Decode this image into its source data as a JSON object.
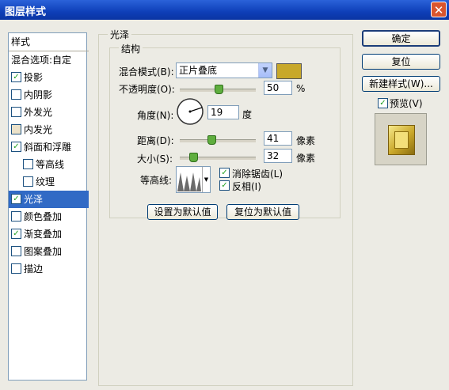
{
  "window": {
    "title": "图层样式"
  },
  "sidebar": {
    "header": "样式",
    "items": [
      {
        "label": "混合选项:自定",
        "checked": null
      },
      {
        "label": "投影",
        "checked": true
      },
      {
        "label": "内阴影",
        "checked": false
      },
      {
        "label": "外发光",
        "checked": false
      },
      {
        "label": "内发光",
        "checked": false
      },
      {
        "label": "斜面和浮雕",
        "checked": true
      },
      {
        "label": "等高线",
        "checked": false
      },
      {
        "label": "纹理",
        "checked": false
      },
      {
        "label": "光泽",
        "checked": true,
        "selected": true
      },
      {
        "label": "颜色叠加",
        "checked": false
      },
      {
        "label": "渐变叠加",
        "checked": true
      },
      {
        "label": "图案叠加",
        "checked": false
      },
      {
        "label": "描边",
        "checked": false
      }
    ]
  },
  "panel": {
    "section_title": "光泽",
    "group_title": "结构",
    "blend_mode_label": "混合模式(B):",
    "blend_mode_value": "正片叠底",
    "blend_color": "#c8a82a",
    "opacity_label": "不透明度(O):",
    "opacity_value": "50",
    "opacity_unit": "%",
    "angle_label": "角度(N):",
    "angle_value": "19",
    "angle_unit": "度",
    "distance_label": "距离(D):",
    "distance_value": "41",
    "distance_unit": "像素",
    "size_label": "大小(S):",
    "size_value": "32",
    "size_unit": "像素",
    "contour_label": "等高线:",
    "antialias_label": "消除锯齿(L)",
    "invert_label": "反相(I)",
    "set_default_button": "设置为默认值",
    "reset_default_button": "复位为默认值"
  },
  "buttons": {
    "ok": "确定",
    "reset": "复位",
    "new_style": "新建样式(W)..."
  },
  "preview": {
    "label": "预览(V)",
    "checked": true
  }
}
